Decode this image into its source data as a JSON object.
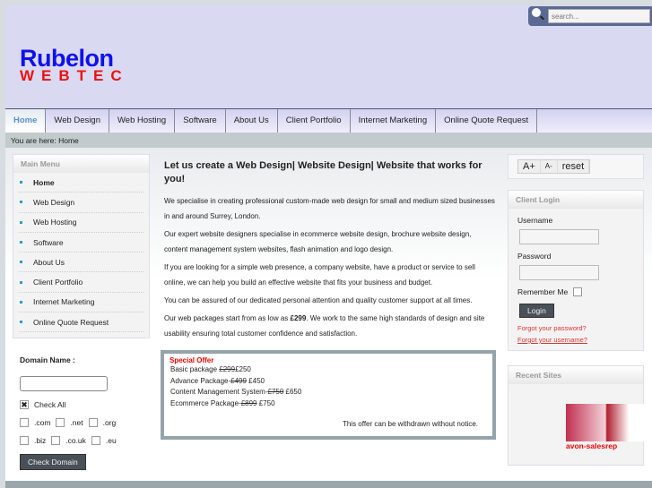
{
  "logo": {
    "line1": "Rubelon",
    "line2": "WEBTEC"
  },
  "search": {
    "placeholder": "search..."
  },
  "nav": [
    "Home",
    "Web Design",
    "Web Hosting",
    "Software",
    "About Us",
    "Client Portfolio",
    "Internet Marketing",
    "Online Quote Request"
  ],
  "breadcrumb": "You are here: Home",
  "main_menu": {
    "title": "Main Menu",
    "items": [
      "Home",
      "Web Design",
      "Web Hosting",
      "Software",
      "About Us",
      "Client Portfolio",
      "Internet Marketing",
      "Online Quote Request"
    ]
  },
  "domain": {
    "label": "Domain Name :",
    "value": "",
    "check_all": "Check All",
    "tlds": [
      ".com",
      ".net",
      ".org",
      ".biz",
      ".co.uk",
      ".eu"
    ],
    "button": "Check Domain"
  },
  "content": {
    "heading": "Let us create a Web Design| Website Design| Website that works for you!",
    "paragraphs": [
      "We specialise in creating professional custom-made web design for small and medium sized businesses in and around Surrey, London.",
      "Our expert website designers specialise in ecommerce website design, brochure website design, content management system websites, flash animation and logo design.",
      "If you are looking for a simple web presence, a company website, have a product or service to sell online, we can help you build an effective website that fits your business and budget.",
      "You can be assured of our dedicated personal attention and quality customer support at all times."
    ],
    "last_pre": "Our web packages start from as low as ",
    "last_price": "£299",
    "last_post": ". We work to the same high standards of design and site usability ensuring total customer confidence and satisfaction."
  },
  "offer": {
    "title": "Special Offer",
    "items": [
      {
        "name": "Basic package ",
        "old": "£299",
        "new": "£250"
      },
      {
        "name": "Advance Package-",
        "old": "£499",
        "new": " £450"
      },
      {
        "name": "Content Management System-",
        "old": "£750",
        "new": " £650"
      },
      {
        "name": "Ecommerce Package-",
        "old": "£899",
        "new": " £750"
      }
    ],
    "note": "This offer can be withdrawn without notice."
  },
  "font_size": {
    "increase": "A+",
    "decrease": "A-",
    "reset": "reset"
  },
  "login": {
    "title": "Client Login",
    "username": "Username",
    "password": "Password",
    "remember": "Remember Me",
    "button": "Login",
    "forgot_password": "Forgot your password?",
    "forgot_username": "Forgot your username?"
  },
  "recent": {
    "title": "Recent Sites",
    "caption": "avon-salesrep"
  }
}
